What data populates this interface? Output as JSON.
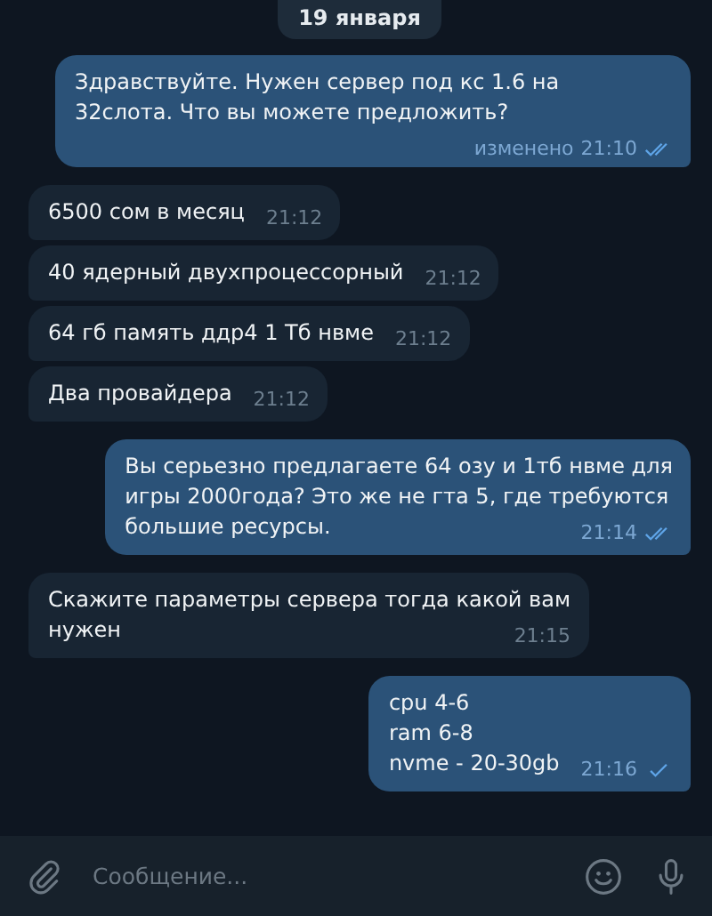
{
  "date_badge": "19 января",
  "messages": [
    {
      "kind": "outgoing",
      "text": "Здравствуйте. Нужен сервер под кс 1.6 на\n32слота. Что вы можете предложить?",
      "edited": "изменено",
      "time": "21:10",
      "read": true
    },
    {
      "kind": "incoming",
      "text": "6500 сом в месяц",
      "time": "21:12"
    },
    {
      "kind": "incoming",
      "text": "40 ядерный двухпроцессорный",
      "time": "21:12"
    },
    {
      "kind": "incoming",
      "text": "64 гб память ддр4 1 Тб нвме",
      "time": "21:12"
    },
    {
      "kind": "incoming",
      "text": "Два провайдера",
      "time": "21:12"
    },
    {
      "kind": "outgoing",
      "text": "Вы серьезно предлагаете 64 озу и 1тб нвме для\nигры 2000года? Это же не гта 5, где требуются\nбольшие ресурсы.",
      "time": "21:14",
      "read": true
    },
    {
      "kind": "incoming",
      "text": "Скажите параметры сервера тогда какой вам\nнужен",
      "time": "21:15"
    },
    {
      "kind": "outgoing",
      "text": "cpu 4-6\nram 6-8\nnvme - 20-30gb",
      "time": "21:16",
      "read": false
    }
  ],
  "composer": {
    "placeholder": "Сообщение..."
  }
}
